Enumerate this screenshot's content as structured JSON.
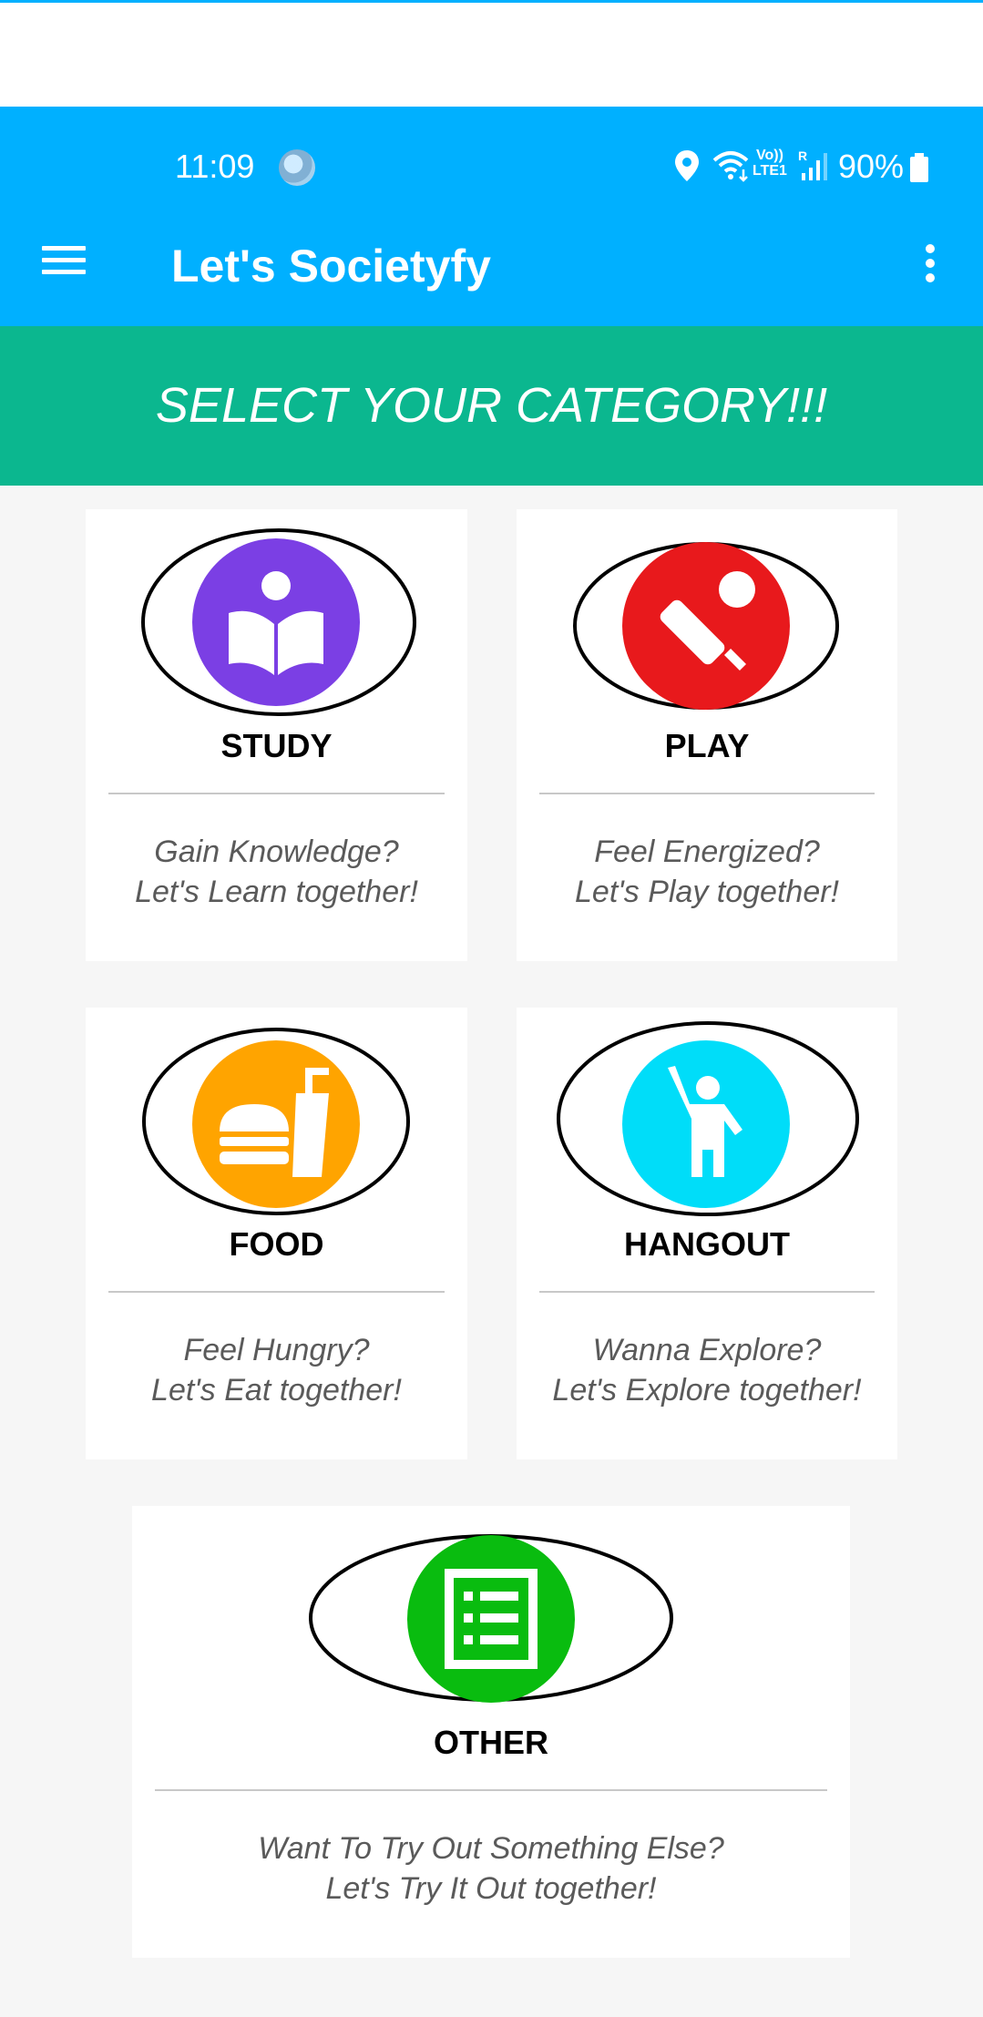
{
  "status_bar": {
    "time": "11:09",
    "network_label": "Vo))\nLTE1",
    "roaming_label": "R",
    "battery": "90%"
  },
  "app_bar": {
    "title": "Let's Societyfy",
    "menu_icon": "hamburger-menu-icon",
    "overflow_icon": "more-vert-icon"
  },
  "banner": {
    "text": "SELECT YOUR CATEGORY!!!"
  },
  "categories": [
    {
      "label": "STUDY",
      "line1": "Gain Knowledge?",
      "line2": "Let's Learn together!",
      "icon": "reading-book-icon",
      "color": "#7b3fe4"
    },
    {
      "label": "PLAY",
      "line1": "Feel Energized?",
      "line2": "Let's Play together!",
      "icon": "cricket-bat-ball-icon",
      "color": "#e8191c"
    },
    {
      "label": "FOOD",
      "line1": "Feel Hungry?",
      "line2": "Let's Eat together!",
      "icon": "fast-food-icon",
      "color": "#ffa400"
    },
    {
      "label": "HANGOUT",
      "line1": "Wanna Explore?",
      "line2": "Let's Explore together!",
      "icon": "person-waving-icon",
      "color": "#00ddf9"
    },
    {
      "label": "OTHER",
      "line1": "Want To Try Out Something Else?",
      "line2": "Let's Try It Out together!",
      "icon": "list-form-icon",
      "color": "#09bc0f"
    }
  ],
  "colors": {
    "app_bar": "#00b0ff",
    "banner": "#0bb78f",
    "background": "#f6f6f6"
  }
}
